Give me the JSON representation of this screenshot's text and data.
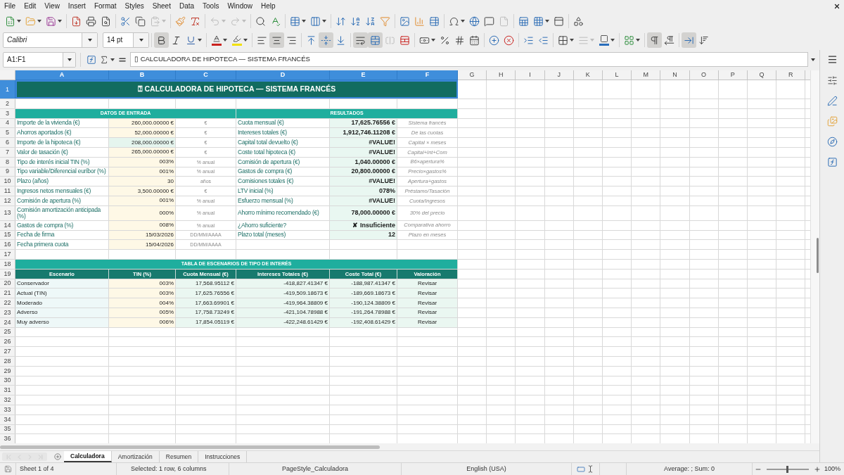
{
  "menu_bar": [
    "File",
    "Edit",
    "View",
    "Insert",
    "Format",
    "Styles",
    "Sheet",
    "Data",
    "Tools",
    "Window",
    "Help"
  ],
  "standard_toolbar": [
    [
      {
        "kind": "new",
        "disabled": false
      },
      {
        "kind": "open",
        "disabled": false
      },
      {
        "kind": "save",
        "disabled": false
      }
    ],
    [
      {
        "kind": "pdf",
        "disabled": false
      },
      {
        "kind": "print",
        "disabled": false
      },
      {
        "kind": "preview",
        "disabled": false
      }
    ],
    [
      {
        "kind": "cut",
        "disabled": false
      },
      {
        "kind": "copy",
        "disabled": false
      },
      {
        "kind": "paste",
        "disabled": true
      }
    ],
    [
      {
        "kind": "clone",
        "disabled": false
      },
      {
        "kind": "clear",
        "disabled": false
      }
    ],
    [
      {
        "kind": "undo",
        "disabled": true
      },
      {
        "kind": "redo",
        "disabled": true
      }
    ],
    [
      {
        "kind": "find",
        "disabled": false
      },
      {
        "kind": "spelling",
        "disabled": false
      }
    ],
    [
      {
        "kind": "row",
        "disabled": false
      },
      {
        "kind": "column",
        "disabled": false
      }
    ],
    [
      {
        "kind": "sort",
        "disabled": false
      },
      {
        "kind": "ascending",
        "disabled": false
      },
      {
        "kind": "descending",
        "disabled": false
      },
      {
        "kind": "autofilter",
        "disabled": false
      }
    ],
    [
      {
        "kind": "image",
        "disabled": false
      },
      {
        "kind": "chart",
        "disabled": false
      },
      {
        "kind": "pivot",
        "disabled": false
      }
    ],
    [
      {
        "kind": "special",
        "disabled": false
      },
      {
        "kind": "hyperlink",
        "disabled": false
      },
      {
        "kind": "comment",
        "disabled": false
      },
      {
        "kind": "headers",
        "disabled": true
      }
    ],
    [
      {
        "kind": "printarea",
        "disabled": false
      },
      {
        "kind": "freeze",
        "disabled": false
      },
      {
        "kind": "split",
        "disabled": false
      }
    ],
    [
      {
        "kind": "draw",
        "disabled": false
      }
    ]
  ],
  "formatting_toolbar": {
    "font_name": "Calibri",
    "font_size": "14 pt",
    "groups": [
      [
        {
          "kind": "bold",
          "on": true,
          "disabled": false
        },
        {
          "kind": "italic",
          "on": false,
          "disabled": false
        },
        {
          "kind": "underline",
          "on": false,
          "disabled": false
        }
      ],
      [
        {
          "kind": "fontcolor",
          "on": false,
          "disabled": false
        },
        {
          "kind": "highlight",
          "on": false,
          "disabled": false
        }
      ],
      [
        {
          "kind": "left",
          "on": false,
          "disabled": false
        },
        {
          "kind": "center",
          "on": true,
          "disabled": false
        },
        {
          "kind": "right",
          "on": false,
          "disabled": false
        }
      ],
      [
        {
          "kind": "top",
          "on": false,
          "disabled": false
        },
        {
          "kind": "middle",
          "on": true,
          "disabled": false
        },
        {
          "kind": "bottom",
          "on": false,
          "disabled": false
        }
      ],
      [
        {
          "kind": "wrap",
          "on": true,
          "disabled": false
        },
        {
          "kind": "mergecenter",
          "on": true,
          "disabled": false
        },
        {
          "kind": "merge",
          "on": false,
          "disabled": true
        },
        {
          "kind": "unmerge",
          "on": false,
          "disabled": false
        }
      ],
      [
        {
          "kind": "currency",
          "on": false,
          "disabled": false
        },
        {
          "kind": "percent",
          "on": false,
          "disabled": false
        },
        {
          "kind": "number",
          "on": false,
          "disabled": false
        },
        {
          "kind": "date",
          "on": false,
          "disabled": false
        }
      ],
      [
        {
          "kind": "adddecimal",
          "on": false,
          "disabled": false
        },
        {
          "kind": "deldecimal",
          "on": false,
          "disabled": false
        }
      ],
      [
        {
          "kind": "indent",
          "on": false,
          "disabled": false
        },
        {
          "kind": "outdent",
          "on": false,
          "disabled": false
        }
      ],
      [
        {
          "kind": "borders",
          "on": false,
          "disabled": false
        },
        {
          "kind": "borderstyle",
          "on": false,
          "disabled": true
        },
        {
          "kind": "bordercolor",
          "on": false,
          "disabled": false
        }
      ],
      [
        {
          "kind": "conditional",
          "on": false,
          "disabled": false
        }
      ],
      [
        {
          "kind": "ltr",
          "on": true,
          "disabled": false
        },
        {
          "kind": "rtl",
          "on": false,
          "disabled": false
        }
      ],
      [
        {
          "kind": "direction",
          "on": true,
          "disabled": false
        },
        {
          "kind": "vertical",
          "on": false,
          "disabled": false
        }
      ]
    ]
  },
  "formula_bar": {
    "name_box": "A1:F1",
    "content": "▯ CALCULADORA DE HIPOTECA — SISTEMA FRANCÉS"
  },
  "sheet": {
    "column_headers": [
      {
        "label": "A",
        "selected": true
      },
      {
        "label": "B",
        "selected": true
      },
      {
        "label": "C",
        "selected": true
      },
      {
        "label": "D",
        "selected": true
      },
      {
        "label": "E",
        "selected": true
      },
      {
        "label": "F",
        "selected": true
      },
      {
        "label": "G",
        "selected": false
      },
      {
        "label": "H",
        "selected": false
      },
      {
        "label": "I",
        "selected": false
      },
      {
        "label": "J",
        "selected": false
      },
      {
        "label": "K",
        "selected": false
      },
      {
        "label": "L",
        "selected": false
      },
      {
        "label": "M",
        "selected": false
      },
      {
        "label": "N",
        "selected": false
      },
      {
        "label": "O",
        "selected": false
      },
      {
        "label": "P",
        "selected": false
      },
      {
        "label": "Q",
        "selected": false
      },
      {
        "label": "R",
        "selected": false
      }
    ],
    "row_headers": [
      {
        "label": "1",
        "selected": true
      },
      {
        "label": "2",
        "selected": false
      },
      {
        "label": "3",
        "selected": false
      },
      {
        "label": "4",
        "selected": false
      },
      {
        "label": "5",
        "selected": false
      },
      {
        "label": "6",
        "selected": false
      },
      {
        "label": "7",
        "selected": false
      },
      {
        "label": "8",
        "selected": false
      },
      {
        "label": "9",
        "selected": false
      },
      {
        "label": "10",
        "selected": false
      },
      {
        "label": "11",
        "selected": false
      },
      {
        "label": "12",
        "selected": false
      },
      {
        "label": "13",
        "selected": false
      },
      {
        "label": "14",
        "selected": false
      },
      {
        "label": "15",
        "selected": false
      },
      {
        "label": "16",
        "selected": false
      },
      {
        "label": "17",
        "selected": false
      },
      {
        "label": "18",
        "selected": false
      },
      {
        "label": "19",
        "selected": false
      },
      {
        "label": "20",
        "selected": false
      },
      {
        "label": "21",
        "selected": false
      },
      {
        "label": "22",
        "selected": false
      },
      {
        "label": "23",
        "selected": false
      },
      {
        "label": "24",
        "selected": false
      },
      {
        "label": "25",
        "selected": false
      },
      {
        "label": "26",
        "selected": false
      },
      {
        "label": "27",
        "selected": false
      },
      {
        "label": "28",
        "selected": false
      },
      {
        "label": "29",
        "selected": false
      },
      {
        "label": "30",
        "selected": false
      },
      {
        "label": "31",
        "selected": false
      },
      {
        "label": "32",
        "selected": false
      },
      {
        "label": "33",
        "selected": false
      },
      {
        "label": "34",
        "selected": false
      },
      {
        "label": "35",
        "selected": false
      },
      {
        "label": "36",
        "selected": false
      }
    ],
    "title": "⍰ CALCULADORA DE HIPOTECA — SISTEMA FRANCÉS",
    "inputs": {
      "heading": "DATOS DE ENTRADA",
      "rows": [
        {
          "label": "Importe de la vivienda (€)",
          "value": "260,000.00000 €",
          "unit": "€",
          "kind": "input"
        },
        {
          "label": "Ahorros aportados (€)",
          "value": "52,000.00000 €",
          "unit": "€",
          "kind": "input"
        },
        {
          "label": "Importe de la hipoteca (€)",
          "value": "208,000.00000 €",
          "unit": "€",
          "kind": "computed"
        },
        {
          "label": "Valor de tasación (€)",
          "value": "265,000.00000 €",
          "unit": "€",
          "kind": "input"
        },
        {
          "label": "Tipo de interés inicial TIN (%)",
          "value": "003%",
          "unit": "% anual",
          "kind": "input"
        },
        {
          "label": "Tipo variable/Diferencial euríbor (%)",
          "value": "001%",
          "unit": "% anual",
          "kind": "input"
        },
        {
          "label": "Plazo (años)",
          "value": "30",
          "unit": "años",
          "kind": "input"
        },
        {
          "label": "Ingresos netos mensuales (€)",
          "value": "3,500.00000 €",
          "unit": "€",
          "kind": "input"
        },
        {
          "label": "Comisión de apertura (%)",
          "value": "001%",
          "unit": "% anual",
          "kind": "input"
        },
        {
          "label": "Comisión amortización anticipada (%)",
          "value": "000%",
          "unit": "% anual",
          "kind": "input"
        },
        {
          "label": "Gastos de compra (%)",
          "value": "008%",
          "unit": "% anual",
          "kind": "input"
        },
        {
          "label": "Fecha de firma",
          "value": "15/03/2026",
          "unit": "DD/MM/AAAA",
          "kind": "input"
        },
        {
          "label": "Fecha primera cuota",
          "value": "15/04/2026",
          "unit": "DD/MM/AAAA",
          "kind": "input"
        }
      ]
    },
    "results": {
      "heading": "RESULTADOS",
      "rows": [
        {
          "label": "Cuota mensual (€)",
          "value": "17,625.76556 €",
          "note": "Sistema francés"
        },
        {
          "label": "Intereses totales (€)",
          "value": "1,912,746.11208 €",
          "note": "De las cuotas"
        },
        {
          "label": "Capital total devuelto (€)",
          "value": "#VALUE!",
          "note": "Capital × meses"
        },
        {
          "label": "Coste total hipoteca (€)",
          "value": "#VALUE!",
          "note": "Capital+Int+Com"
        },
        {
          "label": "Comisión de apertura (€)",
          "value": "1,040.00000 €",
          "note": "B6×apertura%"
        },
        {
          "label": "Gastos de compra (€)",
          "value": "20,800.00000 €",
          "note": "Precio×gastos%"
        },
        {
          "label": "Comisiones totales (€)",
          "value": "#VALUE!",
          "note": "Apertura+gastos"
        },
        {
          "label": "LTV inicial (%)",
          "value": "078%",
          "note": "Préstamo/Tasación"
        },
        {
          "label": "Esfuerzo mensual (%)",
          "value": "#VALUE!",
          "note": "Cuota/Ingresos"
        },
        {
          "label": "Ahorro mínimo recomendado (€)",
          "value": "78,000.00000 €",
          "note": "30% del precio"
        },
        {
          "label": "¿Ahorro suficiente?",
          "value": "✘ Insuficiente",
          "note": "Comparativa ahorro"
        },
        {
          "label": "Plazo total (meses)",
          "value": "12",
          "note": "Plazo en meses"
        }
      ]
    },
    "scenarios": {
      "heading": "TABLA DE ESCENARIOS DE TIPO DE INTERÉS",
      "columns": [
        "Escenario",
        "TIN (%)",
        "Cuota Mensual (€)",
        "Intereses Totales (€)",
        "Coste Total (€)",
        "Valoración"
      ],
      "rows": [
        [
          "Conservador",
          "003%",
          "17,568.95112 €",
          "-418,827.41347 €",
          "-188,987.41347 €",
          "Revisar"
        ],
        [
          "Actual (TIN)",
          "003%",
          "17,625.76556 €",
          "-419,509.18673 €",
          "-189,669.18673 €",
          "Revisar"
        ],
        [
          "Moderado",
          "004%",
          "17,663.69901 €",
          "-419,964.38809 €",
          "-190,124.38809 €",
          "Revisar"
        ],
        [
          "Adverso",
          "005%",
          "17,758.73249 €",
          "-421,104.78988 €",
          "-191,264.78988 €",
          "Revisar"
        ],
        [
          "Muy adverso",
          "006%",
          "17,854.05119 €",
          "-422,248.61429 €",
          "-192,408.61429 €",
          "Revisar"
        ]
      ]
    }
  },
  "sheet_nav": [
    {
      "kind": "first",
      "disabled": true
    },
    {
      "kind": "previous",
      "disabled": true
    },
    {
      "kind": "next",
      "disabled": true
    },
    {
      "kind": "last",
      "disabled": true
    }
  ],
  "sheet_tabs": [
    {
      "label": "Calculadora",
      "selected": true
    },
    {
      "label": "Amortización",
      "selected": false
    },
    {
      "label": "Resumen",
      "selected": false
    },
    {
      "label": "Instrucciones",
      "selected": false
    }
  ],
  "status_bar": {
    "sheet": "Sheet 1 of 4",
    "selection": "Selected: 1 row, 6 columns",
    "page_style": "PageStyle_Calculadora",
    "language": "English (USA)",
    "statistics": "Average: ; Sum: 0",
    "zoom": {
      "reading": "100%",
      "level": 0.5
    }
  }
}
